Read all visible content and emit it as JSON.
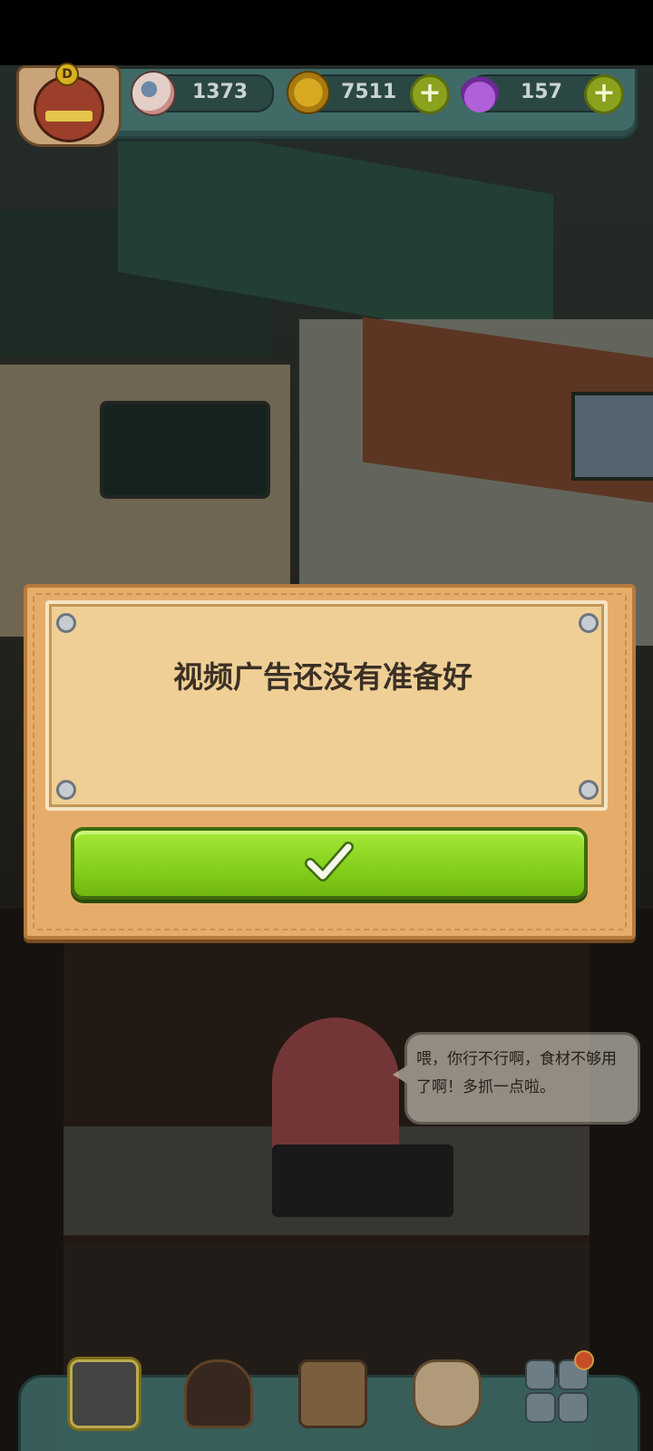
{
  "hud": {
    "eyeballs": {
      "icon": "eyeball-icon",
      "value": "1373"
    },
    "coins": {
      "icon": "coin-icon",
      "value": "7511"
    },
    "potions": {
      "icon": "potion-icon",
      "value": "157"
    },
    "player_badge": {
      "icon": "monster-avatar-icon",
      "level_letter": "D"
    },
    "add_icon": "plus-icon"
  },
  "dialog": {
    "message": "视频广告还没有准备好",
    "confirm_icon": "checkmark-icon"
  },
  "npc": {
    "icon": "octopus-chef-icon",
    "speech": "喂，你行不行啊，食材不够用了啊！多抓一点啦。"
  },
  "bottom_nav": [
    {
      "id": "shop",
      "icon": "shop-icon"
    },
    {
      "id": "furnace",
      "icon": "furnace-icon"
    },
    {
      "id": "book",
      "icon": "recipe-book-icon"
    },
    {
      "id": "bag",
      "icon": "money-bag-icon"
    },
    {
      "id": "menu",
      "icon": "grid-menu-icon"
    }
  ],
  "colors": {
    "accent_green": "#86d11d",
    "wood": "#e6ad6a",
    "paper": "#efcf95",
    "hud_teal": "#3f6a66"
  }
}
